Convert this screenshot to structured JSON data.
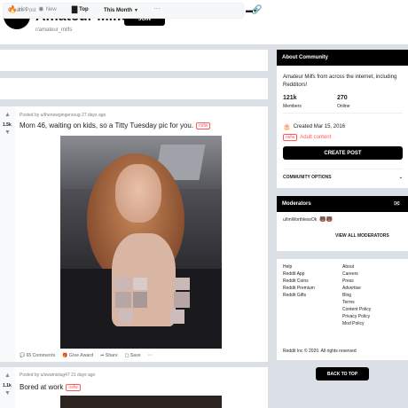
{
  "header": {
    "logo_glyph": "⌒",
    "title": "Amateur Milfs",
    "subreddit": "r/amateur_milfs",
    "join_label": "JOIN"
  },
  "create_post": {
    "placeholder": "Create Post",
    "link_icon": "link-icon"
  },
  "sort": {
    "hot": "Hot",
    "new": "New",
    "top": "Top",
    "period": "This Month",
    "more": "···"
  },
  "posts": [
    {
      "score": "1.5k",
      "meta": "Posted by u/thenewgingersoug 27 days ago",
      "title": "Mom 46, waiting on kids, so a Titty Tuesday pic for you.",
      "tag": "nsfw",
      "comments": "65 Comments",
      "give_award": "Give Award",
      "share": "Share",
      "save": "Save",
      "more": "···"
    },
    {
      "score": "1.1k",
      "meta": "Posted by u/swamislug47 21 days ago",
      "title": "Bored at work",
      "tag": "nsfw"
    }
  ],
  "about": {
    "heading": "About Community",
    "description": "Amateur Milfs from across the internet, including Redditors!",
    "members_count": "121k",
    "members_label": "Members",
    "online_count": "270",
    "online_label": "Online",
    "created": "Created Mar 15, 2016",
    "nsfw_tag": "nsfw",
    "adult_content": "Adult content",
    "create_post_label": "CREATE POST",
    "community_options": "COMMUNITY OPTIONS"
  },
  "moderators": {
    "heading": "Moderators",
    "mod_name": "u/ImWorthlessOk",
    "view_all": "VIEW ALL MODERATORS"
  },
  "footer_links": {
    "left": [
      "Help",
      "Reddit App",
      "Reddit Coins",
      "Reddit Premium",
      "Reddit Gifts"
    ],
    "right": [
      "About",
      "Careers",
      "Press",
      "Advertise",
      "Blog",
      "Terms",
      "Content Policy",
      "Privacy Policy",
      "Mod Policy"
    ],
    "copyright": "Reddit Inc © 2020. All rights reserved"
  },
  "back_to_top": "BACK TO TOP",
  "colors": {
    "nsfw": "#ff585b",
    "background": "#dae0e6"
  }
}
